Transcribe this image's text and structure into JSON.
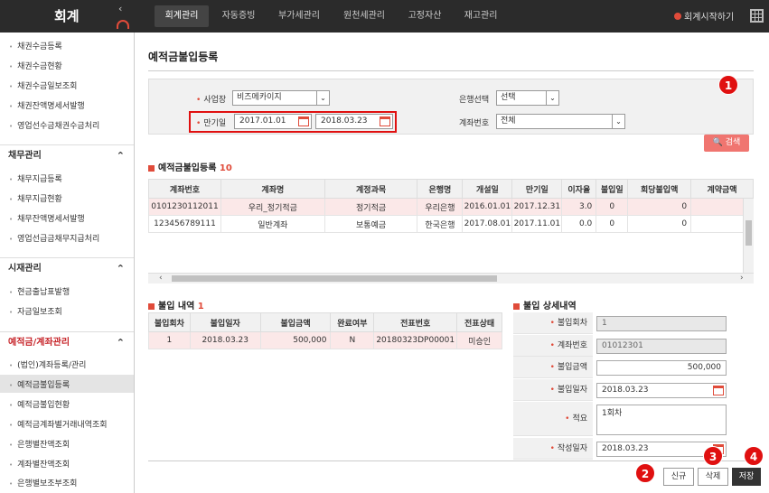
{
  "header": {
    "app_title": "회계",
    "tabs": [
      "회계관리",
      "자동증빙",
      "부가세관리",
      "원천세관리",
      "고정자산",
      "재고관리"
    ],
    "help_label": "회계시작하기"
  },
  "sidebar": {
    "items_top": [
      "채권수금등록",
      "채권수금현황",
      "채권수금일보조회",
      "채권잔액명세서발행",
      "영업선수금채권수금처리"
    ],
    "sections": [
      {
        "title": "채무관리",
        "items": [
          "채무지급등록",
          "채무지급현황",
          "채무잔액명세서발행",
          "영업선급금채무지급처리"
        ]
      },
      {
        "title": "시재관리",
        "items": [
          "현금출납표발행",
          "자금일보조회"
        ]
      },
      {
        "title": "예적금/계좌관리",
        "items": [
          "(법인)계좌등록/관리",
          "예적금불입등록",
          "예적금불입현황",
          "예적금계좌별거래내역조회",
          "은행별잔액조회",
          "계좌별잔액조회",
          "은행별보조부조회"
        ]
      }
    ]
  },
  "page": {
    "title": "예적금불입등록"
  },
  "search": {
    "business_label": "사업장",
    "business_value": "비즈메카이지",
    "maturity_label": "만기일",
    "date_from": "2017.01.01",
    "date_to": "2018.03.23",
    "bank_label": "은행선택",
    "bank_value": "선택",
    "account_label": "계좌번호",
    "account_value": "전체",
    "search_button": "검색"
  },
  "deposit_list": {
    "title": "예적금불입등록",
    "count": "10",
    "columns": [
      "계좌번호",
      "계좌명",
      "계정과목",
      "은행명",
      "개설일",
      "만기일",
      "이자율",
      "불입일",
      "회당불입액",
      "계약금액"
    ],
    "rows": [
      [
        "0101230112011",
        "우리_정기적금",
        "정기적금",
        "우리은행",
        "2016.01.01",
        "2017.12.31",
        "3.0",
        "0",
        "0",
        ""
      ],
      [
        "123456789111",
        "일반계좌",
        "보통예금",
        "한국은행",
        "2017.08.01",
        "2017.11.01",
        "0.0",
        "0",
        "0",
        ""
      ]
    ]
  },
  "payment_list": {
    "title": "불입 내역",
    "count": "1",
    "columns": [
      "불입회차",
      "불입일자",
      "불입금액",
      "완료여부",
      "전표번호",
      "전표상태"
    ],
    "rows": [
      [
        "1",
        "2018.03.23",
        "500,000",
        "N",
        "20180323DP00001",
        "미승인"
      ]
    ]
  },
  "detail": {
    "title": "불입 상세내역",
    "fields": [
      {
        "label": "불입회차",
        "value": "1"
      },
      {
        "label": "계좌번호",
        "value": "01012301"
      },
      {
        "label": "불입금액",
        "value": "500,000"
      },
      {
        "label": "불입일자",
        "value": "2018.03.23"
      },
      {
        "label": "적요",
        "value": "1회차"
      },
      {
        "label": "작성일자",
        "value": "2018.03.23"
      }
    ]
  },
  "actions": {
    "new": "신규",
    "delete": "삭제",
    "save": "저장"
  },
  "callouts": [
    "1",
    "2",
    "3",
    "4"
  ],
  "colors": {
    "accent": "#e04b3a",
    "callout": "#e01010",
    "topbar": "#2b2b2b"
  }
}
